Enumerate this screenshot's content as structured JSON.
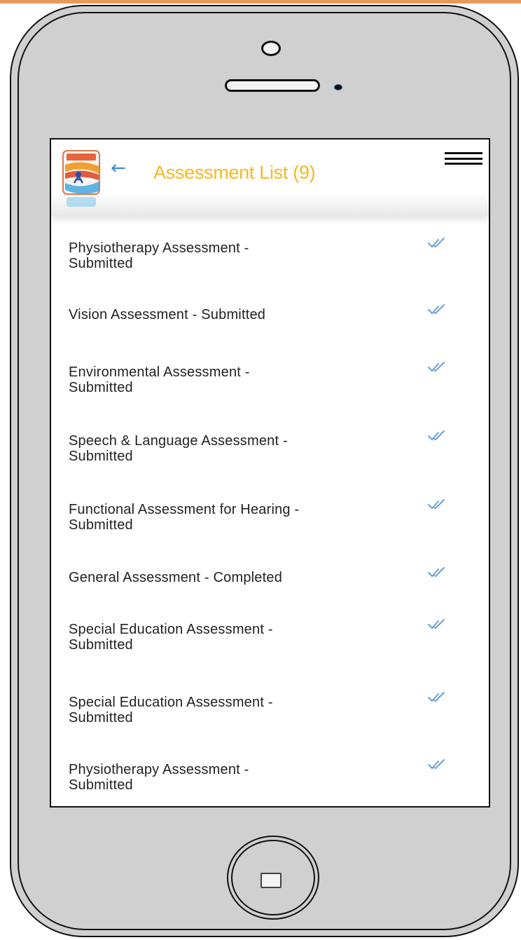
{
  "header": {
    "title": "Assessment List (9)",
    "back_icon": "arrow-left-icon",
    "menu_icon": "hamburger-menu-icon",
    "logo_icon": "app-logo-icon"
  },
  "assessments": [
    {
      "line1": "Physiotherapy Assessment -",
      "line2": "Submitted",
      "status_icon": "double-check-icon"
    },
    {
      "line1": "Vision Assessment - Submitted",
      "line2": "",
      "status_icon": "double-check-icon"
    },
    {
      "line1": "Environmental Assessment -",
      "line2": "Submitted",
      "status_icon": "double-check-icon"
    },
    {
      "line1": "Speech & Language Assessment -",
      "line2": "Submitted",
      "status_icon": "double-check-icon"
    },
    {
      "line1": "Functional Assessment for Hearing -",
      "line2": "Submitted",
      "status_icon": "double-check-icon"
    },
    {
      "line1": "General Assessment - Completed",
      "line2": "",
      "status_icon": "double-check-icon"
    },
    {
      "line1": "Special Education Assessment -",
      "line2": "Submitted",
      "status_icon": "double-check-icon"
    },
    {
      "line1": "Special Education Assessment -",
      "line2": "Submitted",
      "status_icon": "double-check-icon"
    },
    {
      "line1": "Physiotherapy Assessment -",
      "line2": "Submitted",
      "status_icon": "double-check-icon"
    }
  ],
  "colors": {
    "title": "#f5b823",
    "back_arrow": "#3b86d6",
    "check": "#6f9fd8",
    "phone_body": "#d0d0d0"
  }
}
